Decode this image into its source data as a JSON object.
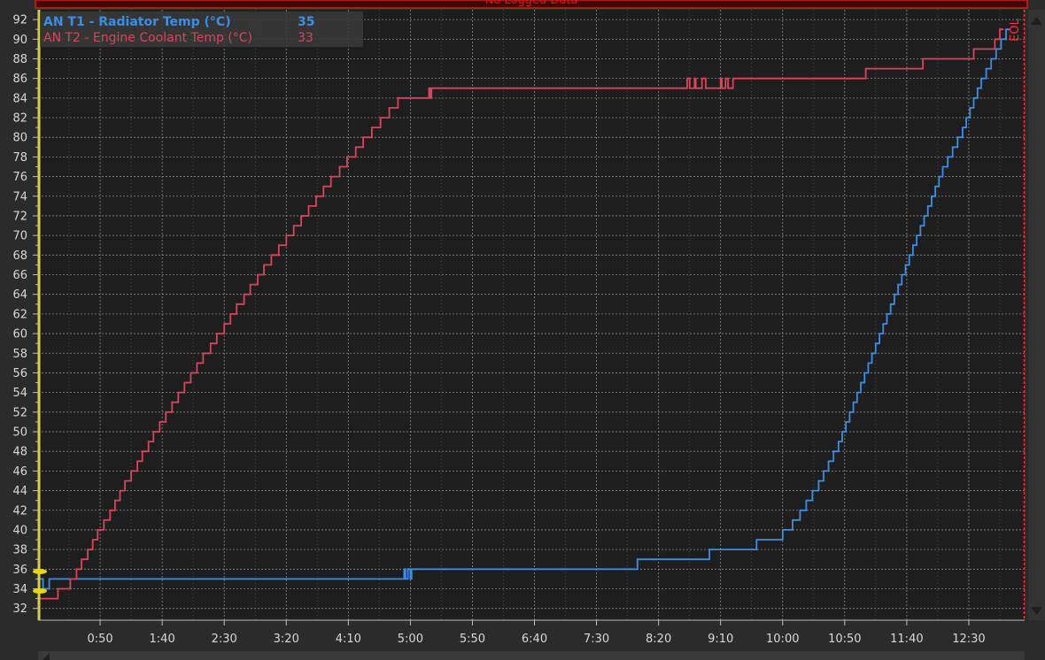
{
  "header": {
    "banner_text": "No Logged Data"
  },
  "eol_label": "EOL",
  "colors": {
    "background": "#2b2b2b",
    "plot_background": "#1e1e1e",
    "grid": "#8a8a8a",
    "series1": "#3a8ee6",
    "series2": "#d8445a",
    "cursor": "#e8d800",
    "end_marker": "#ff3030",
    "banner": "#e01818"
  },
  "legend": [
    {
      "label": "AN T1 - Radiator Temp (°C)",
      "value": "35",
      "color": "#3a8ee6",
      "bold": true
    },
    {
      "label": "AN T2 - Engine Coolant Temp (°C)",
      "value": "33",
      "color": "#d8445a",
      "bold": false
    }
  ],
  "chart_data": {
    "type": "line",
    "step": true,
    "x_unit": "seconds",
    "xlim": [
      0,
      795
    ],
    "ylim": [
      30.8,
      93.0
    ],
    "x_ticks": [
      {
        "value": 50,
        "label": "0:50"
      },
      {
        "value": 100,
        "label": "1:40"
      },
      {
        "value": 150,
        "label": "2:30"
      },
      {
        "value": 200,
        "label": "3:20"
      },
      {
        "value": 250,
        "label": "4:10"
      },
      {
        "value": 300,
        "label": "5:00"
      },
      {
        "value": 350,
        "label": "5:50"
      },
      {
        "value": 400,
        "label": "6:40"
      },
      {
        "value": 450,
        "label": "7:30"
      },
      {
        "value": 500,
        "label": "8:20"
      },
      {
        "value": 550,
        "label": "9:10"
      },
      {
        "value": 600,
        "label": "10:00"
      },
      {
        "value": 650,
        "label": "10:50"
      },
      {
        "value": 700,
        "label": "11:40"
      },
      {
        "value": 750,
        "label": "12:30"
      }
    ],
    "y_ticks": [
      32,
      34,
      36,
      38,
      40,
      42,
      44,
      46,
      48,
      50,
      52,
      54,
      56,
      58,
      60,
      62,
      64,
      66,
      68,
      70,
      72,
      74,
      76,
      78,
      80,
      82,
      84,
      86,
      88,
      90,
      92
    ],
    "grid": true,
    "legend_position": "top-left",
    "series": [
      {
        "name": "AN T1 - Radiator Temp (°C)",
        "color": "#3a8ee6",
        "points": [
          [
            0,
            35
          ],
          [
            4,
            34
          ],
          [
            9,
            35
          ],
          [
            293,
            35
          ],
          [
            295,
            36
          ],
          [
            296,
            35
          ],
          [
            298,
            36
          ],
          [
            300,
            35
          ],
          [
            301,
            36
          ],
          [
            482,
            36
          ],
          [
            483,
            37
          ],
          [
            538,
            37
          ],
          [
            541,
            38
          ],
          [
            576,
            38
          ],
          [
            579,
            39
          ],
          [
            594,
            39
          ],
          [
            600,
            40
          ],
          [
            608,
            41
          ],
          [
            614,
            42
          ],
          [
            619,
            43
          ],
          [
            624,
            44
          ],
          [
            629,
            45
          ],
          [
            633,
            46
          ],
          [
            637,
            47
          ],
          [
            641,
            48
          ],
          [
            645,
            49
          ],
          [
            648,
            50
          ],
          [
            651,
            51
          ],
          [
            654,
            52
          ],
          [
            657,
            53
          ],
          [
            660,
            54
          ],
          [
            663,
            55
          ],
          [
            666,
            56
          ],
          [
            669,
            57
          ],
          [
            672,
            58
          ],
          [
            675,
            59
          ],
          [
            678,
            60
          ],
          [
            681,
            61
          ],
          [
            684,
            62
          ],
          [
            687,
            63
          ],
          [
            690,
            64
          ],
          [
            693,
            65
          ],
          [
            696,
            66
          ],
          [
            699,
            67
          ],
          [
            702,
            68
          ],
          [
            705,
            69
          ],
          [
            708,
            70
          ],
          [
            711,
            71
          ],
          [
            714,
            72
          ],
          [
            717,
            73
          ],
          [
            720,
            74
          ],
          [
            723,
            75
          ],
          [
            726,
            76
          ],
          [
            729,
            77
          ],
          [
            733,
            78
          ],
          [
            737,
            79
          ],
          [
            741,
            80
          ],
          [
            745,
            81
          ],
          [
            748,
            82
          ],
          [
            751,
            83
          ],
          [
            754,
            84
          ],
          [
            757,
            85
          ],
          [
            760,
            86
          ],
          [
            764,
            87
          ],
          [
            768,
            88
          ],
          [
            772,
            89
          ],
          [
            776,
            90
          ],
          [
            780,
            91
          ]
        ]
      },
      {
        "name": "AN T2 - Engine Coolant Temp (°C)",
        "color": "#d8445a",
        "points": [
          [
            0,
            33
          ],
          [
            16,
            34
          ],
          [
            26,
            35
          ],
          [
            31,
            36
          ],
          [
            35,
            37
          ],
          [
            40,
            38
          ],
          [
            44,
            39
          ],
          [
            48,
            40
          ],
          [
            53,
            41
          ],
          [
            58,
            42
          ],
          [
            62,
            43
          ],
          [
            66,
            44
          ],
          [
            70,
            45
          ],
          [
            75,
            46
          ],
          [
            80,
            47
          ],
          [
            84,
            48
          ],
          [
            89,
            49
          ],
          [
            93,
            50
          ],
          [
            98,
            51
          ],
          [
            103,
            52
          ],
          [
            108,
            53
          ],
          [
            113,
            54
          ],
          [
            118,
            55
          ],
          [
            123,
            56
          ],
          [
            128,
            57
          ],
          [
            133,
            58
          ],
          [
            139,
            59
          ],
          [
            144,
            60
          ],
          [
            150,
            61
          ],
          [
            155,
            62
          ],
          [
            160,
            63
          ],
          [
            166,
            64
          ],
          [
            171,
            65
          ],
          [
            177,
            66
          ],
          [
            182,
            67
          ],
          [
            188,
            68
          ],
          [
            194,
            69
          ],
          [
            200,
            70
          ],
          [
            206,
            71
          ],
          [
            212,
            72
          ],
          [
            218,
            73
          ],
          [
            224,
            74
          ],
          [
            230,
            75
          ],
          [
            236,
            76
          ],
          [
            243,
            77
          ],
          [
            249,
            78
          ],
          [
            256,
            79
          ],
          [
            262,
            80
          ],
          [
            269,
            81
          ],
          [
            276,
            82
          ],
          [
            283,
            83
          ],
          [
            290,
            84
          ],
          [
            314,
            84
          ],
          [
            315,
            85
          ],
          [
            316,
            84
          ],
          [
            317,
            85
          ],
          [
            522,
            85
          ],
          [
            523,
            86
          ],
          [
            525,
            85
          ],
          [
            529,
            86
          ],
          [
            530,
            85
          ],
          [
            535,
            86
          ],
          [
            538,
            85
          ],
          [
            550,
            86
          ],
          [
            551,
            85
          ],
          [
            554,
            86
          ],
          [
            556,
            85
          ],
          [
            560,
            86
          ],
          [
            660,
            86
          ],
          [
            667,
            87
          ],
          [
            704,
            87
          ],
          [
            713,
            88
          ],
          [
            744,
            88
          ],
          [
            754,
            89
          ],
          [
            766,
            89
          ],
          [
            771,
            90
          ],
          [
            775,
            91
          ]
        ]
      }
    ]
  }
}
